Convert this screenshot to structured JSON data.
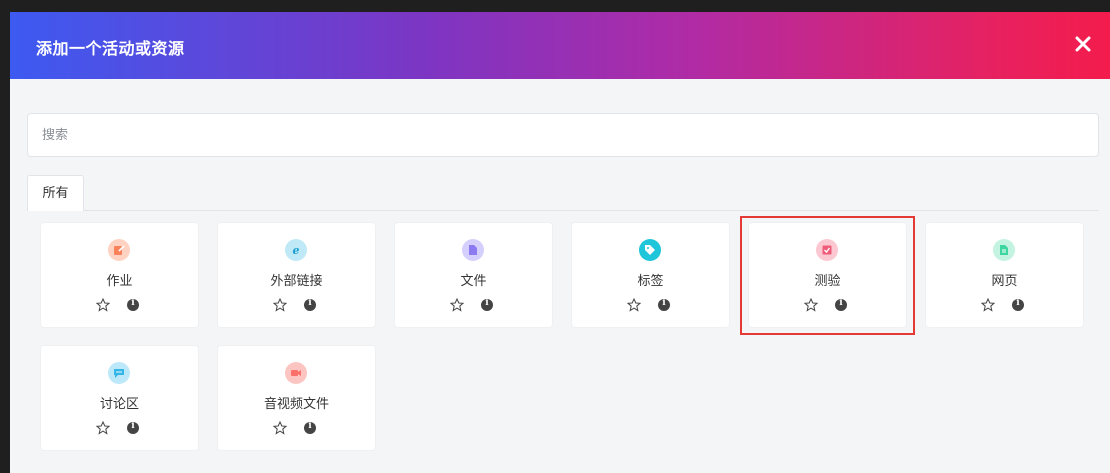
{
  "dialog": {
    "title": "添加一个活动或资源",
    "close_icon": "close-icon",
    "header_gradient": [
      "#3d5af1",
      "#7d35c3",
      "#e8215f",
      "#f31c4c"
    ]
  },
  "search": {
    "placeholder": "搜索",
    "value": ""
  },
  "tabs": [
    {
      "label": "所有",
      "active": true
    }
  ],
  "modules": [
    {
      "label": "作业",
      "icon": "assignment-icon",
      "color": "#f9825a"
    },
    {
      "label": "外部链接",
      "icon": "external-link-icon",
      "color": "#2bb7e4"
    },
    {
      "label": "文件",
      "icon": "file-icon",
      "color": "#8a7cf0"
    },
    {
      "label": "标签",
      "icon": "tag-icon",
      "color": "#1fc5d8"
    },
    {
      "label": "测验",
      "icon": "quiz-icon",
      "color": "#ef5b78"
    },
    {
      "label": "网页",
      "icon": "page-icon",
      "color": "#3ed6a0"
    },
    {
      "label": "讨论区",
      "icon": "forum-icon",
      "color": "#35b6e8"
    },
    {
      "label": "音视频文件",
      "icon": "video-icon",
      "color": "#fb7069"
    }
  ],
  "card_actions": {
    "star_icon": "star-outline-icon",
    "info_icon": "info-icon"
  },
  "highlight_color": "#e53935"
}
